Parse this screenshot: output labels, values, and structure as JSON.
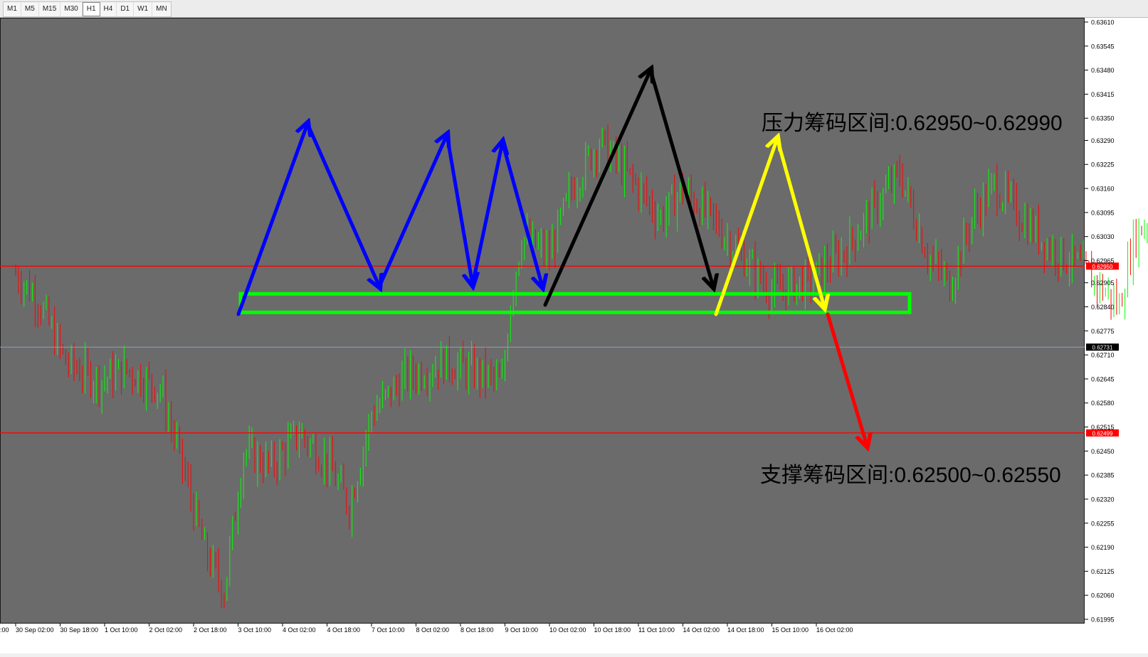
{
  "toolbar": {
    "timeframes": [
      {
        "label": "M1",
        "active": false
      },
      {
        "label": "M5",
        "active": false
      },
      {
        "label": "M15",
        "active": false
      },
      {
        "label": "M30",
        "active": false
      },
      {
        "label": "H1",
        "active": true
      },
      {
        "label": "H4",
        "active": false
      },
      {
        "label": "D1",
        "active": false
      },
      {
        "label": "W1",
        "active": false
      },
      {
        "label": "MN",
        "active": false
      }
    ]
  },
  "chart_data": {
    "type": "candlestick",
    "ylim": [
      0.61995,
      0.6361
    ],
    "y_ticks": [
      "0.63610",
      "0.63545",
      "0.63480",
      "0.63415",
      "0.63350",
      "0.63290",
      "0.63225",
      "0.63160",
      "0.63095",
      "0.63030",
      "0.62965",
      "0.62905",
      "0.62840",
      "0.62775",
      "0.62710",
      "0.62645",
      "0.62580",
      "0.62515",
      "0.62450",
      "0.62385",
      "0.62320",
      "0.62255",
      "0.62190",
      "0.62125",
      "0.62060",
      "0.61995"
    ],
    "x_ticks": [
      "30 Sep 02:00",
      "30 Sep 18:00",
      "1 Oct 10:00",
      "2 Oct 02:00",
      "2 Oct 18:00",
      "3 Oct 10:00",
      "4 Oct 02:00",
      "4 Oct 18:00",
      "7 Oct 10:00",
      "8 Oct 02:00",
      "8 Oct 18:00",
      "9 Oct 10:00",
      "10 Oct 02:00",
      "10 Oct 18:00",
      "11 Oct 10:00",
      "14 Oct 02:00",
      "14 Oct 18:00",
      "15 Oct 10:00",
      "16 Oct 02:00"
    ],
    "x_tick_left_partial": ":00",
    "current_price": "0.62731",
    "current_price_value": 0.62731,
    "horizontal_lines": [
      {
        "price": 0.6295,
        "label": "0.62950",
        "color": "#ff0000"
      },
      {
        "price": 0.62499,
        "label": "0.62499",
        "color": "#ff0000"
      }
    ],
    "support_box": {
      "price_top": 0.62875,
      "price_bottom": 0.62825,
      "color": "#00ff00"
    },
    "annotations": [
      {
        "text": "压力筹码区间:0.62950~0.62990"
      },
      {
        "text": "支撑筹码区间:0.62500~0.62550"
      }
    ],
    "arrow_paths": [
      {
        "color": "#0000ff",
        "points": [
          [
            0.6282,
            0.63335
          ],
          [
            0.62895,
            0.63305
          ],
          [
            0.6289,
            0.63285
          ],
          [
            0.62895,
            0.6329
          ]
        ]
      },
      {
        "color": "#000000",
        "points": [
          [
            0.62845,
            0.6348
          ],
          [
            0.62895
          ]
        ]
      },
      {
        "color": "#ffff00",
        "points": [
          [
            0.6282,
            0.63295
          ],
          [
            0.6284
          ]
        ]
      },
      {
        "color": "#ff0000",
        "points": [
          [
            0.6282,
            0.62465
          ]
        ]
      }
    ],
    "up_color": "#00ff00",
    "down_color": "#ff0000",
    "background": "#6b6b6b",
    "grid": false
  }
}
